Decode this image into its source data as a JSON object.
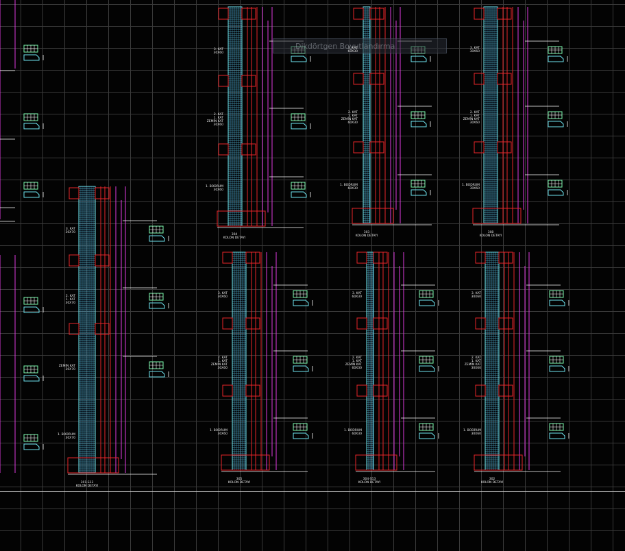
{
  "app": {
    "tooltip": "Dikdörtgen Boyutlandırma"
  },
  "colors": {
    "background": "#030303",
    "grid": "#3a3a3a",
    "outline": "#e8262a",
    "rebar_cyan": "#6fe6f0",
    "rebar_magenta": "#e23be2",
    "text": "#e8e8e8",
    "section_green": "#7dffb0"
  },
  "columns": [
    {
      "id": "c1",
      "caption_line1": "304",
      "caption_line2": "KOLON DETAYI",
      "labels": [
        "3. KAT\n30X60",
        "2. KAT\n1. KAT\nZEMİN KAT\n30X60",
        "1. BODRUM\n30X60"
      ]
    },
    {
      "id": "c2",
      "caption_line1": "303",
      "caption_line2": "KOLON DETAYI",
      "labels": [
        "3. KAT\n60X30",
        "2. KAT\n1. KAT\nZEMİN KAT\n60X30",
        "1. BODRUM\n60X30"
      ]
    },
    {
      "id": "c3",
      "caption_line1": "308",
      "caption_line2": "KOLON DETAYI",
      "labels": [
        "3. KAT\n30X60",
        "2. KAT\n1. KAT\nZEMİN KAT\n30X60",
        "1. BODRUM\n30X60"
      ]
    },
    {
      "id": "c4",
      "caption_line1": "301-S13",
      "caption_line2": "KOLON DETAYI",
      "labels": [
        "3. KAT\n30X70",
        "2. KAT\n1. KAT\n30X70",
        "ZEMİN KAT\n30X70",
        "1. BODRUM\n30X70"
      ]
    },
    {
      "id": "c5",
      "caption_line1": "305",
      "caption_line2": "KOLON DETAYI",
      "labels": [
        "3. KAT\n30X60",
        "2. KAT\n1. KAT\nZEMİN KAT\n30X60",
        "1. BODRUM\n30X60"
      ]
    },
    {
      "id": "c6",
      "caption_line1": "304-S13",
      "caption_line2": "KOLON DETAYI",
      "labels": [
        "3. KAT\n60X30",
        "2. KAT\n1. KAT\nZEMİN KAT\n60X30",
        "1. BODRUM\n60X30"
      ]
    },
    {
      "id": "c7",
      "caption_line1": "302",
      "caption_line2": "KOLON DETAYI",
      "labels": [
        "3. KAT\n30X60",
        "2. KAT\n1. KAT\nZEMİN KAT\n30X60",
        "1. BODRUM\n30X60"
      ]
    }
  ]
}
